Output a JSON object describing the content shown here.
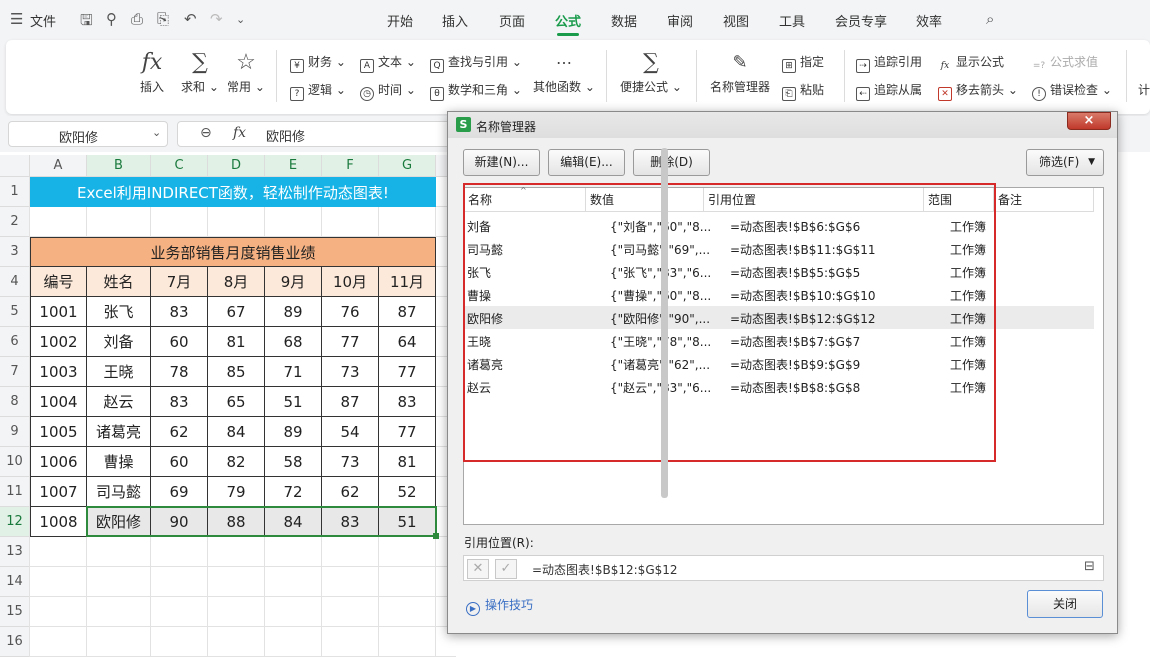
{
  "titlebar": {
    "file_label": "文件",
    "tabs": [
      "开始",
      "插入",
      "页面",
      "公式",
      "数据",
      "审阅",
      "视图",
      "工具",
      "会员专享",
      "效率"
    ],
    "active_tab": "公式"
  },
  "ribbon": {
    "insert_fn": "插入",
    "sum": "求和",
    "common": "常用",
    "finance": "财务",
    "text": "文本",
    "lookup": "查找与引用",
    "logic": "逻辑",
    "time": "时间",
    "math": "数学和三角",
    "other": "其他函数",
    "quick": "便捷公式",
    "name_mgr": "名称管理器",
    "define": "指定",
    "paste": "粘贴",
    "trace_prec": "追踪引用",
    "show_formula": "显示公式",
    "eval": "公式求值",
    "trace_dep": "追踪从属",
    "remove_arrows": "移去箭头",
    "error_check": "错误检查",
    "calc": "计"
  },
  "formula_bar": {
    "name_box": "欧阳修",
    "fx": "fx",
    "content": "欧阳修"
  },
  "sheet": {
    "columns": [
      "A",
      "B",
      "C",
      "D",
      "E",
      "F",
      "G"
    ],
    "rows": [
      "1",
      "2",
      "3",
      "4",
      "5",
      "6",
      "7",
      "8",
      "9",
      "10",
      "11",
      "12",
      "13",
      "14",
      "15",
      "16"
    ],
    "banner": "Excel利用INDIRECT函数，轻松制作动态图表!",
    "table_title": "业务部销售月度销售业绩",
    "headers": [
      "编号",
      "姓名",
      "7月",
      "8月",
      "9月",
      "10月",
      "11月"
    ],
    "data": [
      [
        "1001",
        "张飞",
        "83",
        "67",
        "89",
        "76",
        "87"
      ],
      [
        "1002",
        "刘备",
        "60",
        "81",
        "68",
        "77",
        "64"
      ],
      [
        "1003",
        "王晓",
        "78",
        "85",
        "71",
        "73",
        "77"
      ],
      [
        "1004",
        "赵云",
        "83",
        "65",
        "51",
        "87",
        "83"
      ],
      [
        "1005",
        "诸葛亮",
        "62",
        "84",
        "89",
        "54",
        "77"
      ],
      [
        "1006",
        "曹操",
        "60",
        "82",
        "58",
        "73",
        "81"
      ],
      [
        "1007",
        "司马懿",
        "69",
        "79",
        "72",
        "62",
        "52"
      ],
      [
        "1008",
        "欧阳修",
        "90",
        "88",
        "84",
        "83",
        "51"
      ]
    ]
  },
  "dialog": {
    "title": "名称管理器",
    "new_btn": "新建(N)...",
    "edit_btn": "编辑(E)...",
    "delete_btn": "删除(D)",
    "filter_btn": "筛选(F)",
    "columns": [
      "名称",
      "数值",
      "引用位置",
      "范围",
      "备注"
    ],
    "rows": [
      {
        "name": "刘备",
        "value": "{\"刘备\",\"60\",\"8...",
        "ref": "=动态图表!$B$6:$G$6",
        "scope": "工作簿"
      },
      {
        "name": "司马懿",
        "value": "{\"司马懿\",\"69\",...",
        "ref": "=动态图表!$B$11:$G$11",
        "scope": "工作簿"
      },
      {
        "name": "张飞",
        "value": "{\"张飞\",\"83\",\"6...",
        "ref": "=动态图表!$B$5:$G$5",
        "scope": "工作簿"
      },
      {
        "name": "曹操",
        "value": "{\"曹操\",\"60\",\"8...",
        "ref": "=动态图表!$B$10:$G$10",
        "scope": "工作簿"
      },
      {
        "name": "欧阳修",
        "value": "{\"欧阳修\",\"90\",...",
        "ref": "=动态图表!$B$12:$G$12",
        "scope": "工作簿"
      },
      {
        "name": "王晓",
        "value": "{\"王晓\",\"78\",\"8...",
        "ref": "=动态图表!$B$7:$G$7",
        "scope": "工作簿"
      },
      {
        "name": "诸葛亮",
        "value": "{\"诸葛亮\",\"62\",...",
        "ref": "=动态图表!$B$9:$G$9",
        "scope": "工作簿"
      },
      {
        "name": "赵云",
        "value": "{\"赵云\",\"83\",\"6...",
        "ref": "=动态图表!$B$8:$G$8",
        "scope": "工作簿"
      }
    ],
    "selected_row": 4,
    "ref_label": "引用位置(R):",
    "ref_value": "=动态图表!$B$12:$G$12",
    "tip": "操作技巧",
    "close_btn": "关闭"
  },
  "colors": {
    "accent": "#1a9b4b",
    "banner": "#17b3e6",
    "table_title": "#f5b182",
    "header_row": "#fde9d9",
    "highlight": "#d62a2a"
  }
}
